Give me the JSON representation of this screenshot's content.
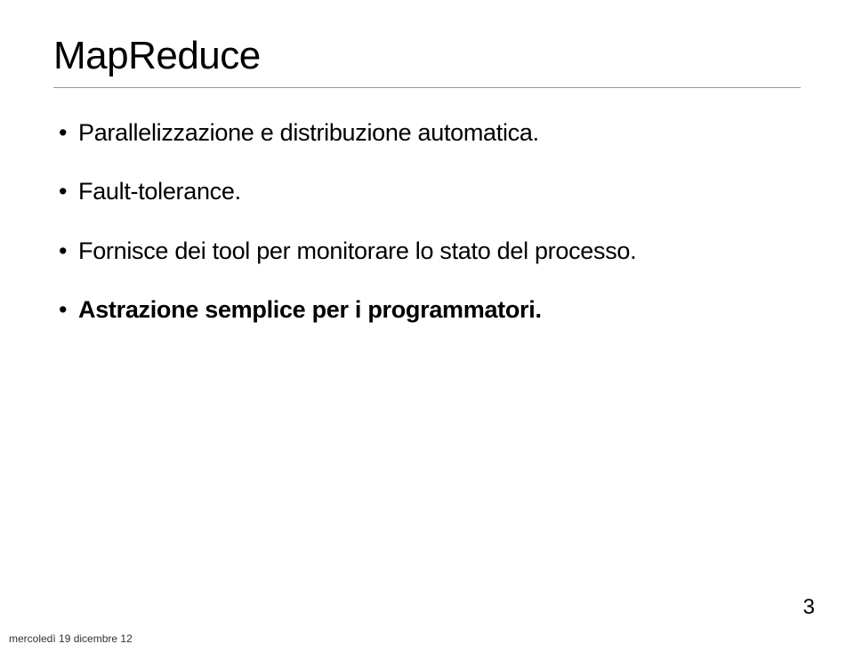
{
  "title": "MapReduce",
  "bullets": [
    {
      "text": "Parallelizzazione e distribuzione automatica.",
      "bold": false
    },
    {
      "text": "Fault-tolerance.",
      "bold": false
    },
    {
      "text": "Fornisce dei tool per monitorare lo stato del processo.",
      "bold": false
    },
    {
      "text": "Astrazione semplice per i programmatori.",
      "bold": true
    }
  ],
  "footer_date": "mercoledì 19 dicembre 12",
  "page_number": "3"
}
